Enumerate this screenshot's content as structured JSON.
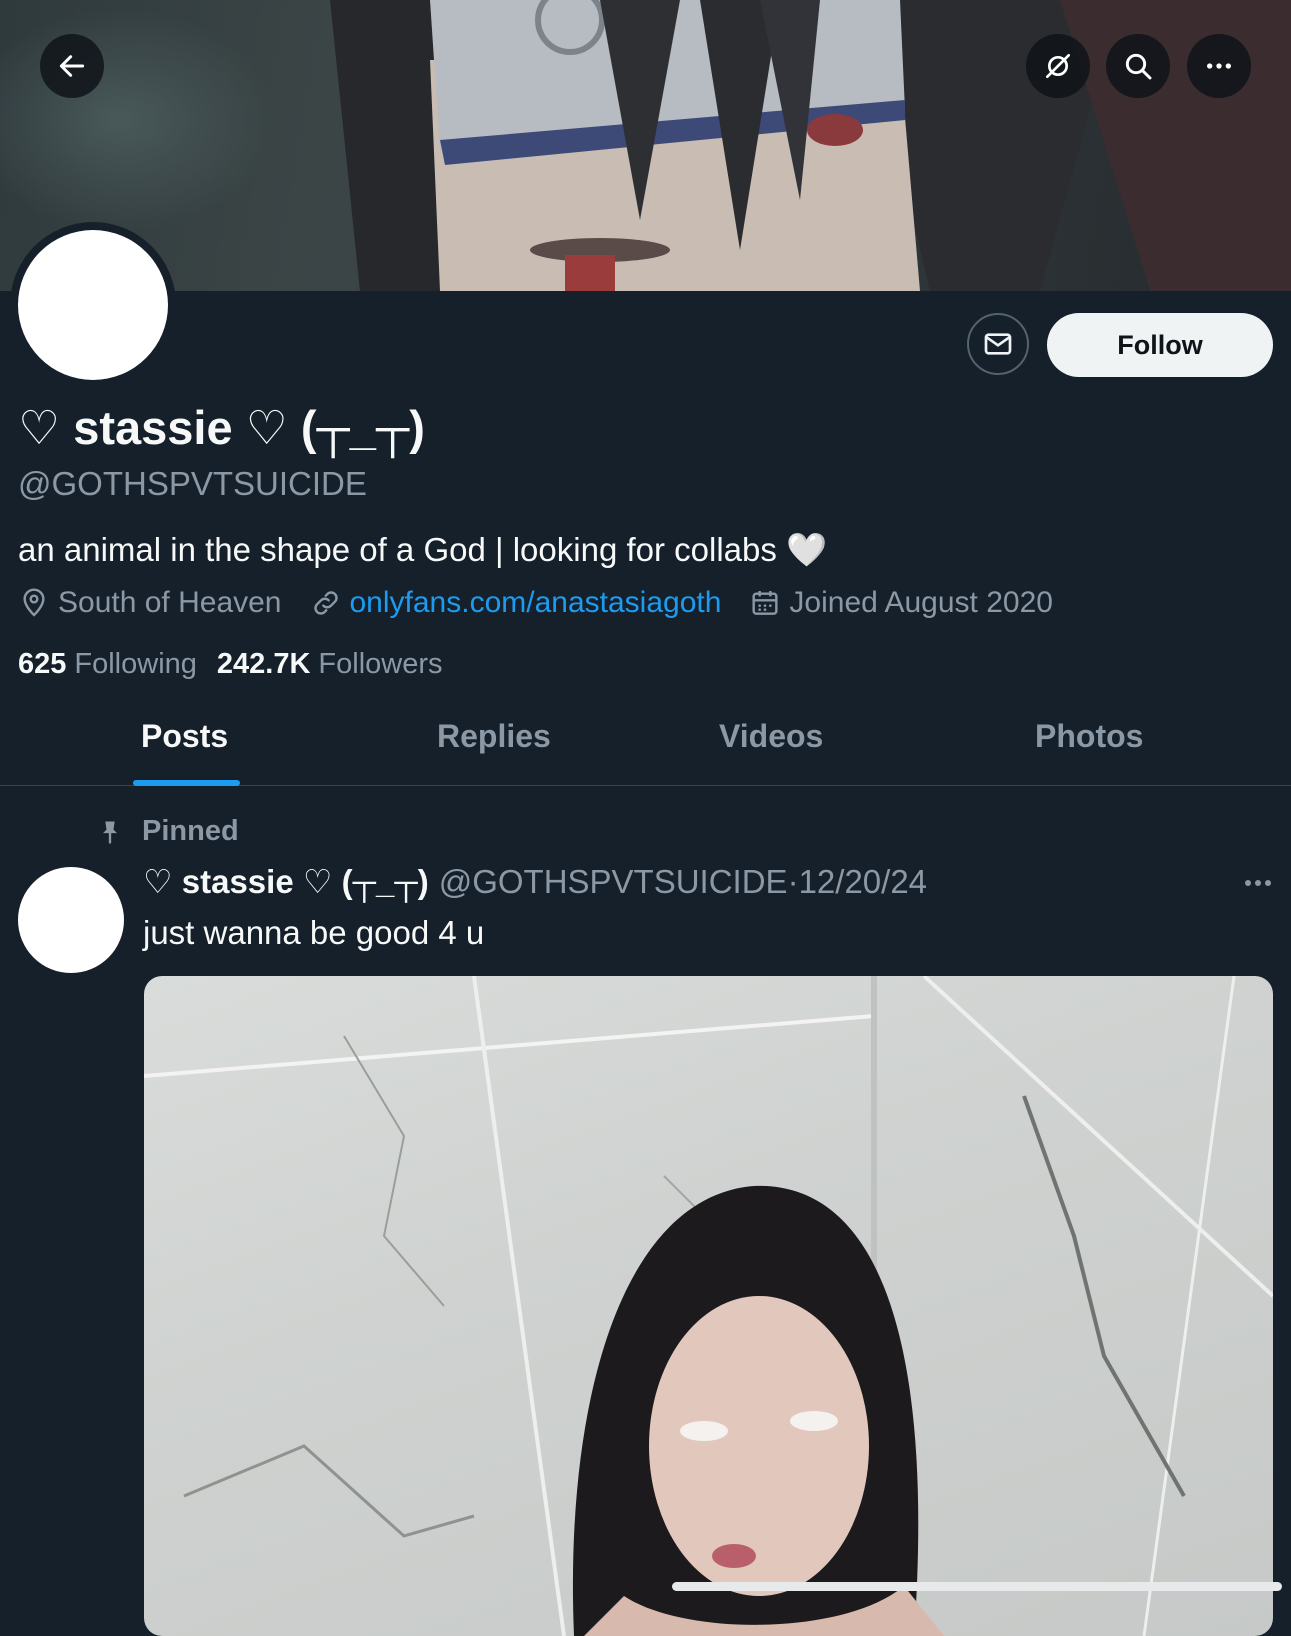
{
  "profile": {
    "display_name": "♡ stassie ♡ (┬_┬)",
    "handle": "@GOTHSPVTSUICIDE",
    "bio": "an animal in the shape of a God | looking for collabs 🤍",
    "location": "South of Heaven",
    "website": "onlyfans.com/anastasiagoth",
    "joined": "Joined August 2020",
    "following_count": "625",
    "following_label": "Following",
    "followers_count": "242.7K",
    "followers_label": "Followers"
  },
  "actions": {
    "follow_label": "Follow"
  },
  "tabs": [
    {
      "label": "Posts",
      "active": true
    },
    {
      "label": "Replies",
      "active": false
    },
    {
      "label": "Videos",
      "active": false
    },
    {
      "label": "Photos",
      "active": false
    }
  ],
  "post": {
    "pinned_label": "Pinned",
    "author_name": "♡ stassie ♡ (┬_┬)",
    "author_handle": "@GOTHSPVTSUICIDE",
    "separator": "·",
    "date": "12/20/24",
    "text": "just wanna be good 4 u"
  },
  "icons": {
    "back": "arrow-left-icon",
    "grok": "grok-icon",
    "search": "search-icon",
    "more": "more-icon",
    "message": "envelope-icon",
    "location": "location-pin-icon",
    "link": "link-icon",
    "calendar": "calendar-icon",
    "pin": "pin-icon"
  },
  "colors": {
    "background": "#15202b",
    "accent": "#1d9bf0",
    "muted_text": "#8b98a5",
    "follow_button_bg": "#eff3f4"
  }
}
